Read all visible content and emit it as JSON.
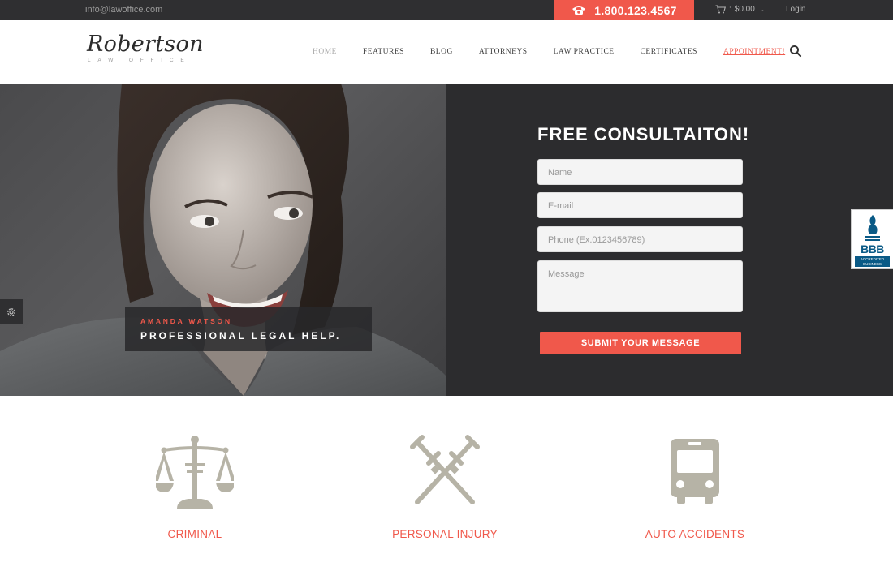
{
  "topbar": {
    "email": "info@lawoffice.com",
    "phone": "1.800.123.4567",
    "cart": "$0.00",
    "login": "Login"
  },
  "header": {
    "logo_script": "Robertson",
    "logo_sub": "LAW OFFICE",
    "nav": [
      {
        "label": "HOME"
      },
      {
        "label": "FEATURES"
      },
      {
        "label": "BLOG"
      },
      {
        "label": "ATTORNEYS"
      },
      {
        "label": "LAW PRACTICE"
      },
      {
        "label": "CERTIFICATES"
      },
      {
        "label": "APPOINTMENT!"
      }
    ]
  },
  "hero": {
    "caption_name": "AMANDA WATSON",
    "caption_tagline": "PROFESSIONAL LEGAL HELP."
  },
  "form": {
    "title": "FREE CONSULTAITON!",
    "name_placeholder": "Name",
    "email_placeholder": "E-mail",
    "phone_placeholder": "Phone (Ex.0123456789)",
    "message_placeholder": "Message",
    "submit": "SUBMIT YOUR MESSAGE"
  },
  "badge": {
    "text": "BBB",
    "sub1": "ACCREDITED",
    "sub2": "BUSINESS"
  },
  "services": [
    {
      "label": "CRIMINAL",
      "icon": "scales-icon"
    },
    {
      "label": "PERSONAL INJURY",
      "icon": "crutches-icon"
    },
    {
      "label": "AUTO ACCIDENTS",
      "icon": "bus-icon"
    }
  ],
  "colors": {
    "accent": "#f0584b",
    "dark": "#2f2f31",
    "icon_gray": "#b6b3a6"
  }
}
